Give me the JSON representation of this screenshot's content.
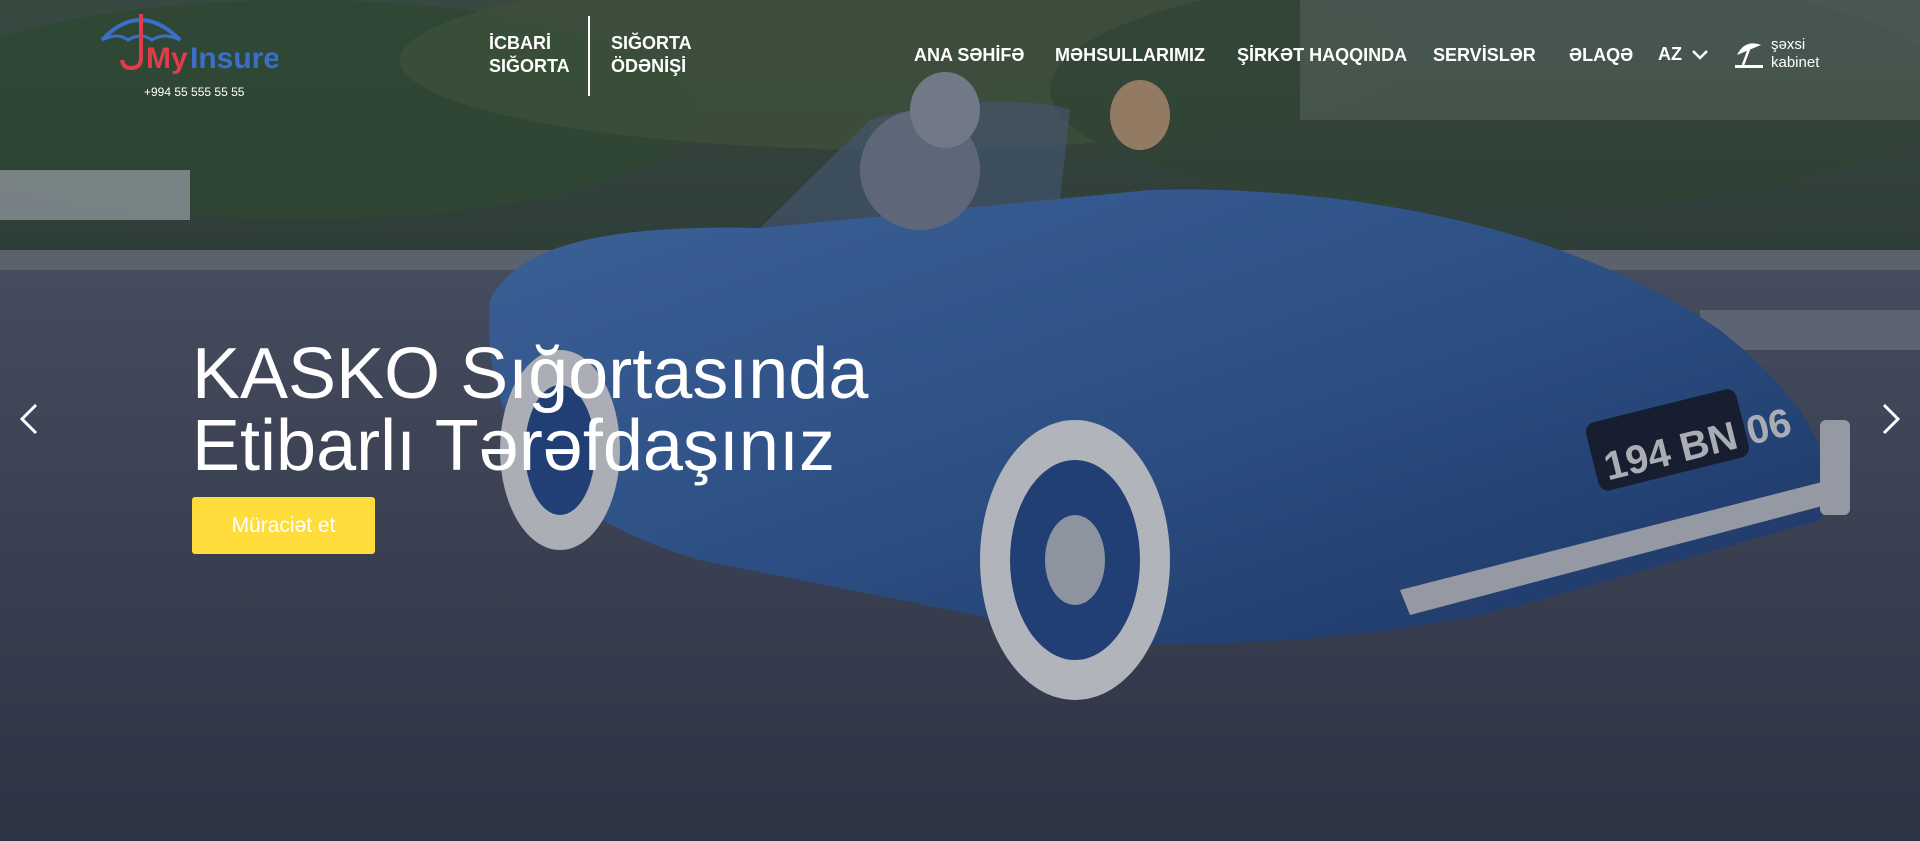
{
  "brand": {
    "logo_text": "MyInsure",
    "phone": "+994 55 555 55 55"
  },
  "quick_links": [
    {
      "line1": "İCBARİ",
      "line2": "SIĞORTA"
    },
    {
      "line1": "SIĞORTA",
      "line2": "ÖDƏNİŞİ"
    }
  ],
  "nav": {
    "items": [
      {
        "label": "ANA SƏHİFƏ"
      },
      {
        "label": "MƏHSULLARIMIZ"
      },
      {
        "label": "ŞİRKƏT HAQQINDA"
      },
      {
        "label": "SERVİSLƏR"
      },
      {
        "label": "ƏLAQƏ"
      }
    ],
    "language": "AZ",
    "cabinet": {
      "line1": "şəxsi",
      "line2": "kabinet"
    }
  },
  "hero": {
    "headline_line1": "KASKO Sığortasında",
    "headline_line2": "Etibarlı Tərəfdaşınız",
    "cta_label": "Müraciət et",
    "plate": "194 BN 06"
  },
  "colors": {
    "accent_yellow": "#fddc3b",
    "logo_blue": "#3a6ec7",
    "logo_red": "#e23b4a",
    "car_blue": "#3d6aa8"
  },
  "icons": {
    "prev": "chevron-left-icon",
    "next": "chevron-right-icon",
    "language_dropdown": "chevron-down-icon",
    "cabinet": "umbrella-icon"
  }
}
